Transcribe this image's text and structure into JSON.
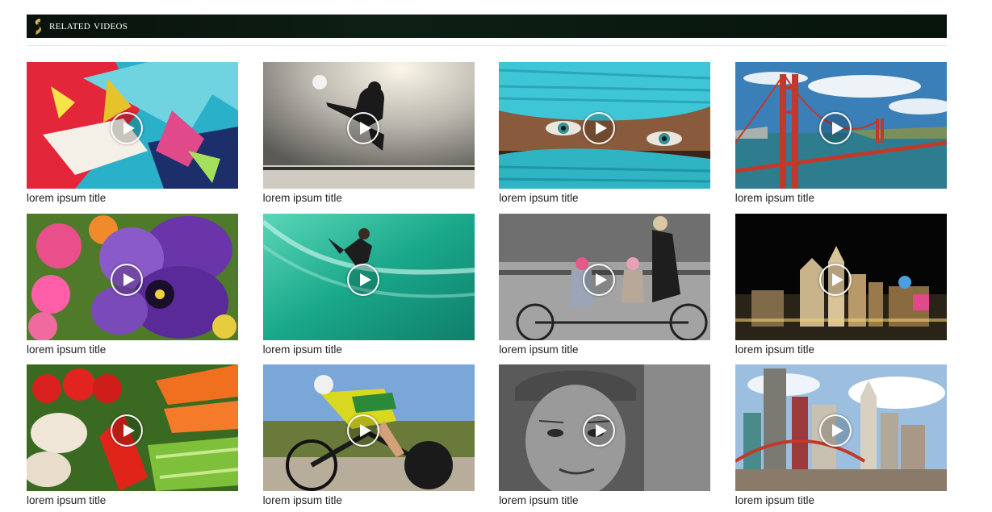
{
  "section": {
    "title": "Related Videos",
    "logo_icon": "gold-s-emblem-icon"
  },
  "colors": {
    "header_bg": "#0a1a10",
    "header_text": "#ffffff",
    "logo_gold": "#c9a44a",
    "caption_text": "#222222"
  },
  "videos": [
    {
      "title": "lorem ipsum title",
      "thumbnail": "abstract-paint-splash"
    },
    {
      "title": "lorem ipsum title",
      "thumbnail": "martial-arts-jump-silhouette"
    },
    {
      "title": "lorem ipsum title",
      "thumbnail": "eyes-turquoise-scarf"
    },
    {
      "title": "lorem ipsum title",
      "thumbnail": "golden-gate-bridge"
    },
    {
      "title": "lorem ipsum title",
      "thumbnail": "purple-pansy-flowers"
    },
    {
      "title": "lorem ipsum title",
      "thumbnail": "surfer-green-wave"
    },
    {
      "title": "lorem ipsum title",
      "thumbnail": "family-tandem-bicycle"
    },
    {
      "title": "lorem ipsum title",
      "thumbnail": "las-vegas-night-skyline"
    },
    {
      "title": "lorem ipsum title",
      "thumbnail": "fresh-vegetables"
    },
    {
      "title": "lorem ipsum title",
      "thumbnail": "racing-cyclist"
    },
    {
      "title": "lorem ipsum title",
      "thumbnail": "old-man-portrait-bw"
    },
    {
      "title": "lorem ipsum title",
      "thumbnail": "las-vegas-day-skyline"
    }
  ]
}
